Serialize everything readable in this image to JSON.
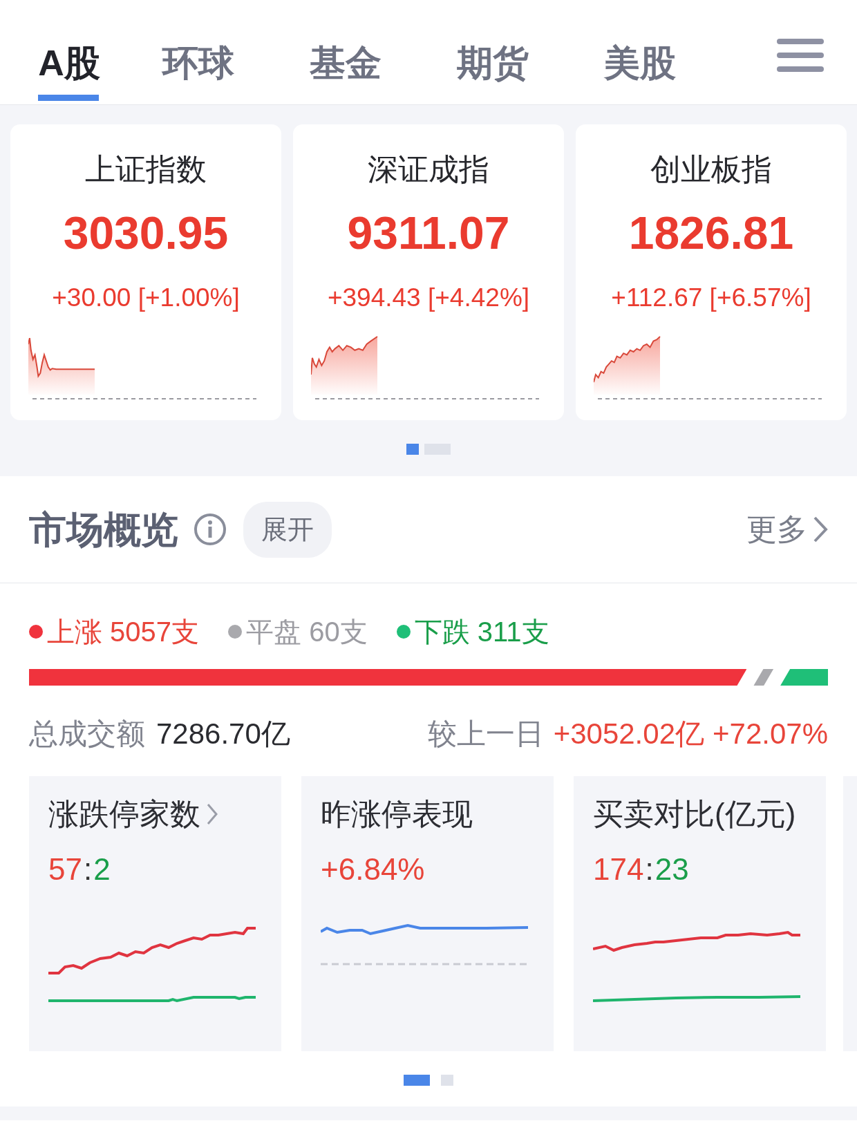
{
  "tabs": [
    {
      "label": "A股",
      "selected": true
    },
    {
      "label": "环球",
      "selected": false
    },
    {
      "label": "基金",
      "selected": false
    },
    {
      "label": "期货",
      "selected": false
    },
    {
      "label": "美股",
      "selected": false
    }
  ],
  "indices": [
    {
      "name": "上证指数",
      "value": "3030.95",
      "change": "+30.00 [+1.00%]"
    },
    {
      "name": "深证成指",
      "value": "9311.07",
      "change": "+394.43 [+4.42%]"
    },
    {
      "name": "创业板指",
      "value": "1826.81",
      "change": "+112.67 [+6.57%]"
    }
  ],
  "index_pages": [
    {
      "selected": true
    },
    {
      "selected": false
    }
  ],
  "overview": {
    "title": "市场概览",
    "expand": "展开",
    "more": "更多",
    "breadth": [
      {
        "label": "上涨 5057支",
        "color": "#f0333d"
      },
      {
        "label": "平盘 60支",
        "color": "#a9a9ad"
      },
      {
        "label": "下跌 311支",
        "color": "#1fbf78"
      }
    ],
    "turnover_label": "总成交额",
    "turnover": "7286.70亿",
    "compare_label": "较上一日",
    "compare_amount": "+3052.02亿",
    "compare_pct": "+72.07%",
    "stats": [
      {
        "kind": "ratio",
        "title": "涨跌停家数",
        "link": true,
        "up": "57",
        "separator": ":",
        "down": "2"
      },
      {
        "kind": "percent",
        "title": "昨涨停表现",
        "link": false,
        "value": "+6.84%"
      },
      {
        "kind": "ratio",
        "title": "买卖对比(亿元)",
        "link": false,
        "up": "174",
        "separator": ":",
        "down": "23"
      }
    ],
    "stat_pages": [
      {
        "selected": true
      },
      {
        "selected": false
      }
    ]
  }
}
